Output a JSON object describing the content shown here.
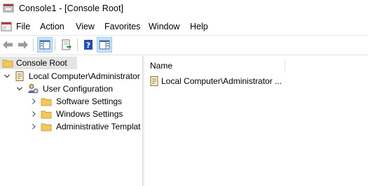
{
  "window": {
    "title": "Console1 - [Console Root]"
  },
  "menu": [
    "File",
    "Action",
    "View",
    "Favorites",
    "Window",
    "Help"
  ],
  "toolbar": {
    "buttons": [
      "back-icon",
      "forward-icon",
      "show-hide-tree-icon",
      "export-list-icon",
      "help-icon",
      "show-hide-action-pane-icon"
    ]
  },
  "tree": {
    "root": "Console Root",
    "computer": "Local Computer\\Administrator",
    "user_config": "User Configuration",
    "children": [
      "Software Settings",
      "Windows Settings",
      "Administrative Templat"
    ]
  },
  "list": {
    "column": "Name",
    "items": [
      "Local Computer\\Administrator ..."
    ]
  },
  "colors": {
    "selection": "#e5e5e5",
    "folder": "#f3c95a",
    "toolbar_active": "#cce4f7",
    "help_blue": "#1f4fb4"
  }
}
